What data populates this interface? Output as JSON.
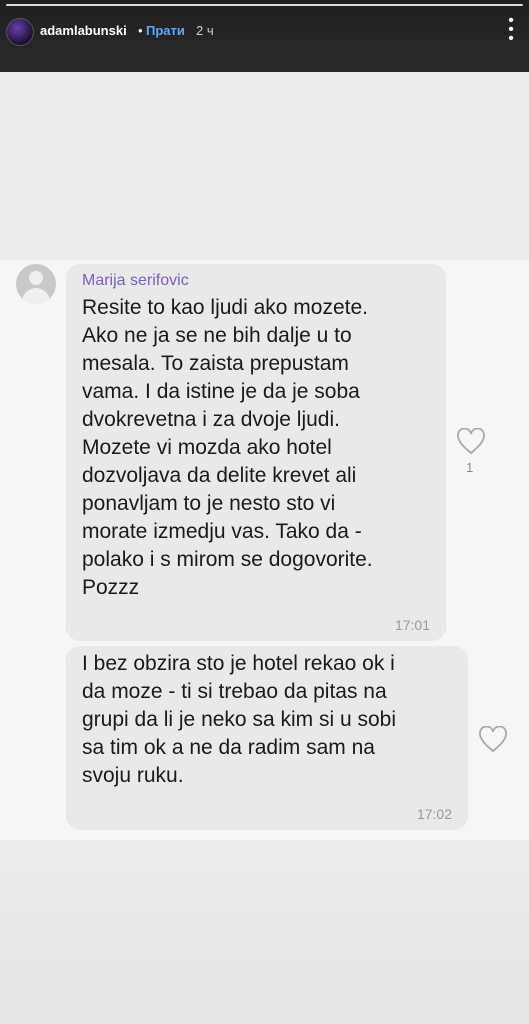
{
  "story": {
    "username": "adamlabunski",
    "separator": "•",
    "follow_label": "Прати",
    "time_ago": "2 ч",
    "progress_percent": 100,
    "more_icon": "more-vertical-icon"
  },
  "chat": {
    "messages": [
      {
        "sender": "Marija serifovic",
        "text": "Resite to kao ljudi ako mozete.\nAko ne ja se ne bih dalje u to\nmesala. To zaista prepustam\nvama. I da istine je da je soba\ndvokrevetna i za dvoje ljudi.\nMozete vi mozda ako hotel\ndozvoljava da delite krevet ali\nponavljam to je nesto sto vi\nmorate izmedju vas. Tako da -\npolako i s mirom se dogovorite.\nPozzz",
        "time": "17:01",
        "like_count": "1",
        "like_icon": "heart-outline-icon"
      },
      {
        "text": "I bez obzira sto je hotel rekao ok i\nda moze - ti si trebao da pitas na\ngrupi da li je neko sa kim si u sobi\nsa tim ok a ne da radim sam na\nsvoju ruku.",
        "time": "17:02",
        "like_icon": "heart-outline-icon"
      }
    ]
  },
  "colors": {
    "header_bg": "#222222",
    "follow_link": "#5ea8ff",
    "sender_name": "#7a5cc2",
    "bubble_bg": "#e9e9e9"
  }
}
